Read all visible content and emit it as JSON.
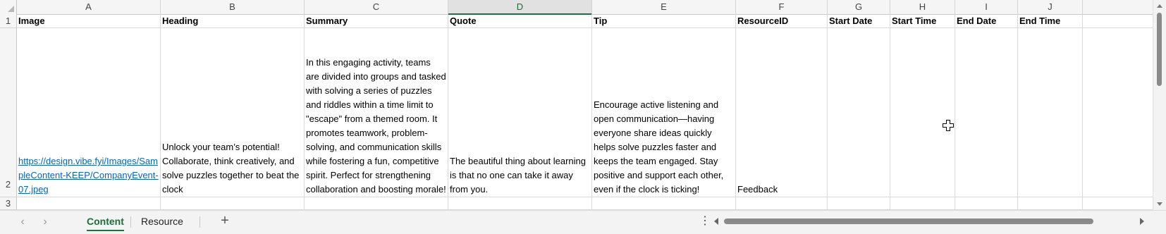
{
  "columns": [
    "A",
    "B",
    "C",
    "D",
    "E",
    "F",
    "G",
    "H",
    "I",
    "J"
  ],
  "selected_column": "D",
  "rows": [
    "1",
    "2",
    "3"
  ],
  "headers": {
    "a": "Image",
    "b": "Heading",
    "c": "Summary",
    "d": "Quote",
    "e": "Tip",
    "f": "ResourceID",
    "g": "Start Date",
    "h": "Start Time",
    "i": "End Date",
    "j": "End Time"
  },
  "row2": {
    "image_link": "https://design.vibe.fyi/Images/SampleContent-KEEP/CompanyEvent-07.jpeg",
    "heading": "Unlock your team’s potential! Collaborate, think creatively, and solve puzzles together to beat the clock",
    "summary": "In this engaging activity, teams are divided into groups and tasked with solving a series of puzzles and riddles within a time limit to \"escape\" from a themed room. It promotes teamwork, problem-solving, and communication skills while fostering a fun, competitive spirit. Perfect for strengthening collaboration and boosting morale!",
    "quote": "The beautiful thing about learning is that no one can take it away from you.",
    "tip": "Encourage active listening and open communication—having everyone share ideas quickly helps solve puzzles faster and keeps the team engaged. Stay positive and support each other, even if the clock is ticking!",
    "resource_id": "Feedback"
  },
  "sheet_tabs": [
    {
      "label": "Content",
      "active": true
    },
    {
      "label": "Resource",
      "active": false
    }
  ],
  "icons": {
    "nav_prev": "chevron-left-icon",
    "nav_next": "chevron-right-icon",
    "add_sheet": "plus-icon",
    "options": "more-vertical-icon",
    "cursor": "cell-select-cursor-icon"
  },
  "colors": {
    "accent": "#1e7145",
    "link": "#0563c1"
  },
  "glyphs": {
    "prev": "‹",
    "next": "›",
    "add": "+",
    "kebab": "⋮"
  }
}
